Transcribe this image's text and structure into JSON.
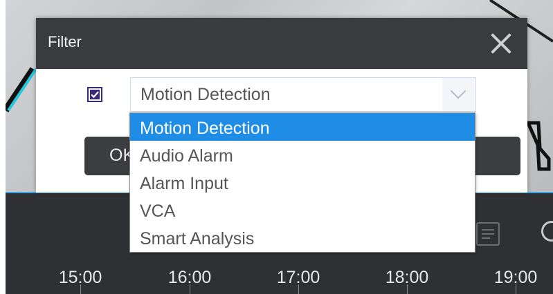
{
  "dialog": {
    "title": "Filter",
    "close_icon": "close-icon",
    "checkbox_checked": true,
    "select_value": "Motion Detection",
    "ok_label": "OK"
  },
  "dropdown": {
    "options": [
      "Motion Detection",
      "Audio Alarm",
      "Alarm Input",
      "VCA",
      "Smart Analysis"
    ],
    "selected_index": 0
  },
  "timeline": {
    "ticks": [
      "15:00",
      "16:00",
      "17:00",
      "18:00",
      "19:00"
    ]
  },
  "colors": {
    "accent": "#1f8ce6",
    "header_bg": "#3a3b3f",
    "timeline_bg": "#2f3034",
    "checkbox": "#3a2a7a"
  }
}
